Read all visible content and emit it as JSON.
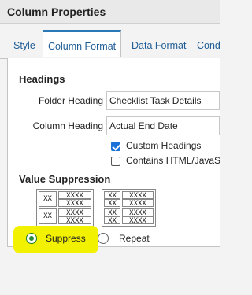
{
  "dialog": {
    "title": "Column Properties"
  },
  "tabs": [
    "Style",
    "Column Format",
    "Data Format",
    "Cond"
  ],
  "headings": {
    "section_title": "Headings",
    "folder_label": "Folder Heading",
    "folder_value": "Checklist Task Details",
    "column_label": "Column Heading",
    "column_value": "Actual End Date",
    "custom_headings_label": "Custom Headings",
    "custom_headings_checked": true,
    "contains_html_label": "Contains HTML/JavaS",
    "contains_html_checked": false
  },
  "value_suppression": {
    "section_title": "Value Suppression",
    "suppress_label": "Suppress",
    "repeat_label": "Repeat",
    "selected": "Suppress",
    "sample_a": "XX",
    "sample_b": "XXXX"
  },
  "colors": {
    "accent": "#2b78b8",
    "link": "#1f5d96",
    "check": "#1a73d9",
    "highlight": "#f2f200"
  }
}
